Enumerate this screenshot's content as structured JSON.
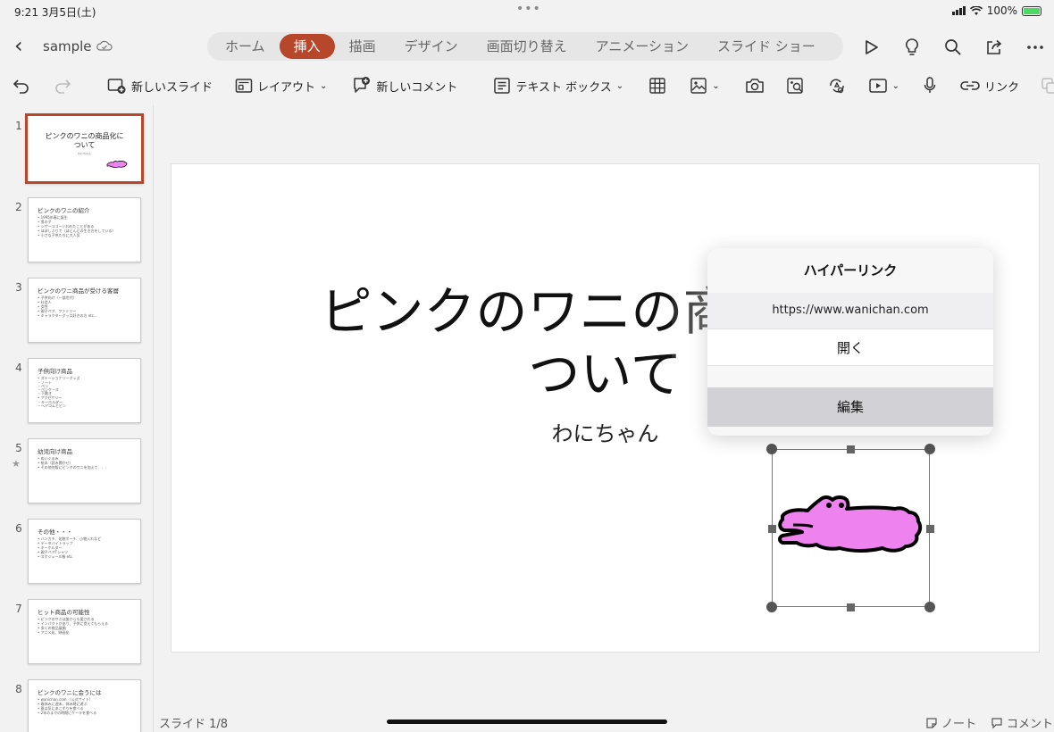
{
  "status_bar": {
    "time": "9:21",
    "date": "3月5日(土)",
    "battery": "100%"
  },
  "header": {
    "document_name": "sample",
    "tabs": [
      "ホーム",
      "挿入",
      "描画",
      "デザイン",
      "画面切り替え",
      "アニメーション",
      "スライド ショー"
    ],
    "active_tab": "挿入"
  },
  "toolbar": {
    "new_slide": "新しいスライド",
    "layout": "レイアウト",
    "new_comment": "新しいコメント",
    "text_box": "テキスト ボックス",
    "link": "リンク"
  },
  "thumbnails": [
    {
      "num": "1",
      "title": "ピンクのワニの商品化に",
      "title2": "ついて",
      "lines": [
        "わにちゃん"
      ]
    },
    {
      "num": "2",
      "title": "ピンクのワニの紹介",
      "lines": [
        "• 1995年春に誕生",
        "• 男の子",
        "• シザーコゴーいわれたことがある",
        "• ほぼしぶりで（ほとんどの生き方をしている）",
        "• 小さな子供たちに大人気"
      ]
    },
    {
      "num": "3",
      "title": "ピンクのワニ商品が受ける客層",
      "lines": [
        "• 子供向け（一部世代）",
        "• 社会人",
        "• 女性",
        "• 親子ペア、ファミリー",
        "• キャラクターグッズ好きの方 etc..."
      ]
    },
    {
      "num": "4",
      "title": "子供向け商品",
      "lines": [
        "• ステーショナリーグッズ",
        "  ・ノート",
        "  ・ペン",
        "  ・ぺンケース",
        "  ・下敷き",
        "• アクセサリー",
        "  ・キーホルダー",
        "  ・ヘアゴムとピン"
      ]
    },
    {
      "num": "5",
      "title": "幼児向け商品",
      "lines": [
        "• ぬいぐるみ",
        "• 絵本（読み聞かせ）",
        "• その他何版にピンクのワニを加えて．．．"
      ]
    },
    {
      "num": "6",
      "title": "その他・・・",
      "lines": [
        "• ハンカチ、化粧ポーチ、小物入れなど",
        "• データバイトラップ",
        "• キーホルダー",
        "• 親子ペアTシャツ",
        "• スケジュール帳 etc."
      ]
    },
    {
      "num": "7",
      "title": "ヒット商品の可能性",
      "lines": [
        "• ピンクのワニは誰からも愛される",
        "• インパクトがあり、子供に覚えてもらえる",
        "• 多くの商品展開",
        "• アニメ化、映画化"
      ]
    },
    {
      "num": "8",
      "title": "ピンクのワニに会うには",
      "lines": [
        "• wanichan.com （公式サイト）",
        "• 春休みに週末、休み時に遊ぶ",
        "• 夏は気にあこずりを食べる",
        "• 2年のまでの時期にケーキを食べる"
      ]
    }
  ],
  "slide": {
    "title_line1": "ピンクのワニの商品化に",
    "title_line2": "ついて",
    "subtitle": "わにちゃん"
  },
  "popup": {
    "title": "ハイパーリンク",
    "url": "https://www.wanichan.com",
    "open": "開く",
    "edit": "編集"
  },
  "footer": {
    "slide_count": "スライド 1/8",
    "notes": "ノート",
    "comments": "コメント"
  },
  "colors": {
    "accent": "#b7472a",
    "croc_pink": "#ee82ee"
  }
}
